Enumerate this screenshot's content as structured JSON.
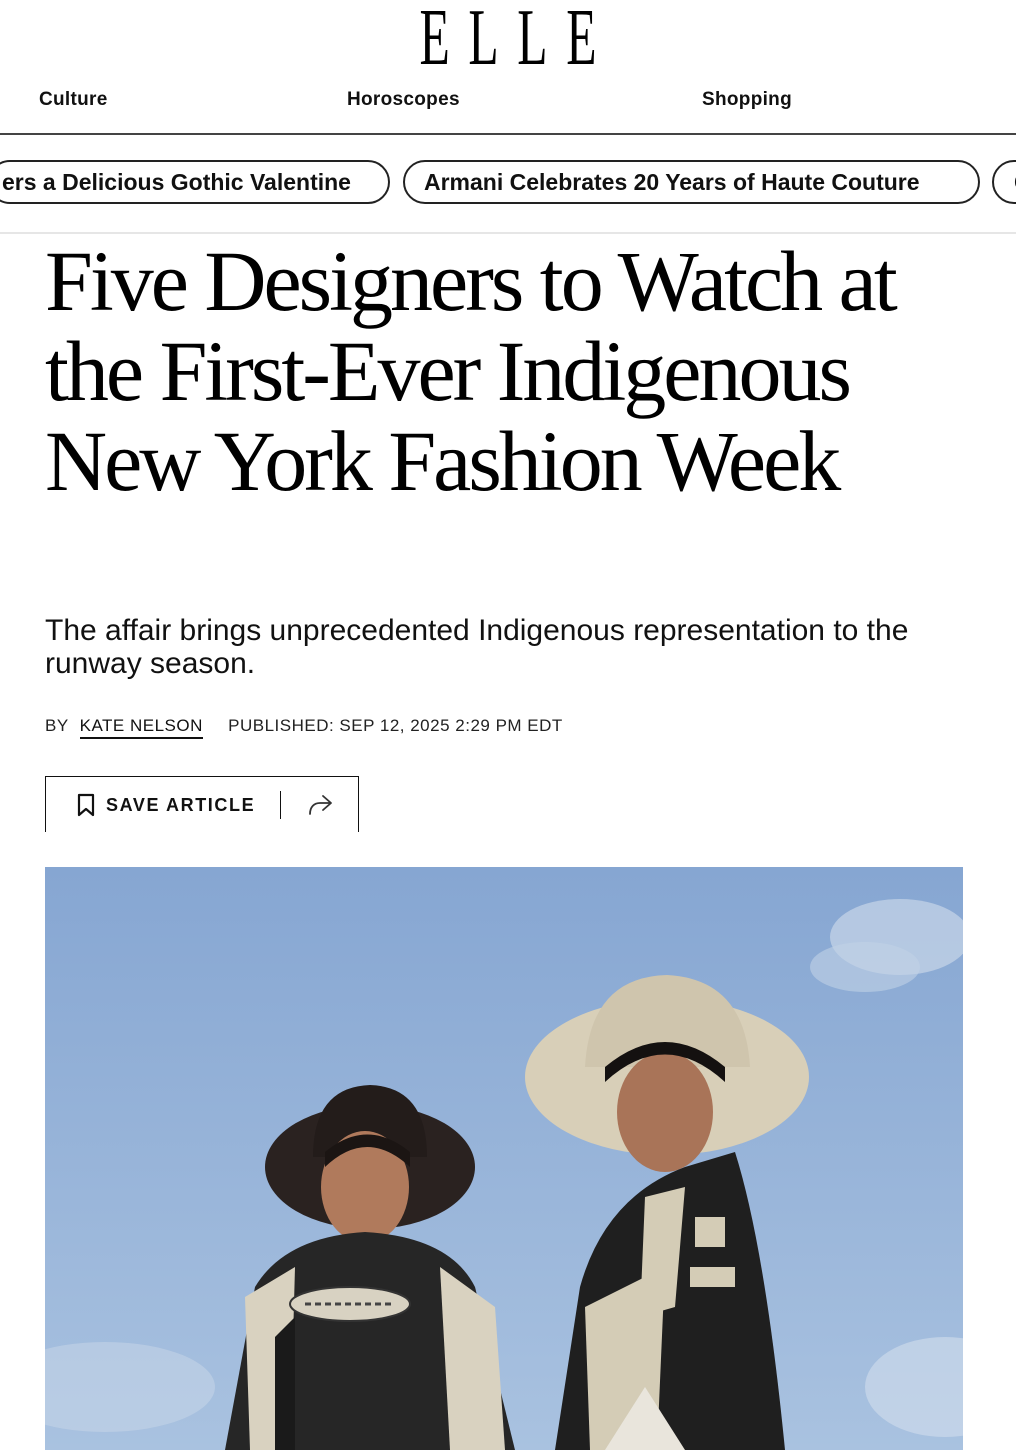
{
  "brand": {
    "logo": "ELLE"
  },
  "nav": {
    "items": [
      {
        "label": "Culture"
      },
      {
        "label": "Horoscopes"
      },
      {
        "label": "Shopping"
      }
    ]
  },
  "trending": {
    "pills": [
      {
        "label": "ers a Delicious Gothic Valentine"
      },
      {
        "label": "Armani Celebrates 20 Years of Haute Couture"
      },
      {
        "label": "C"
      }
    ]
  },
  "article": {
    "headline": "Five Designers to Watch at the First-Ever Indigenous New York Fashion Week",
    "dek": "The affair brings unprecedented Indigenous representation to the runway season.",
    "byline_prefix": "BY",
    "author": "KATE NELSON",
    "published": "PUBLISHED: SEP 12, 2025 2:29 PM EDT"
  },
  "actions": {
    "save_label": "SAVE ARTICLE",
    "save_icon": "bookmark-icon",
    "share_icon": "share-icon"
  },
  "colors": {
    "text": "#000000",
    "sky": "#8fb0d6",
    "rule": "#444444"
  }
}
